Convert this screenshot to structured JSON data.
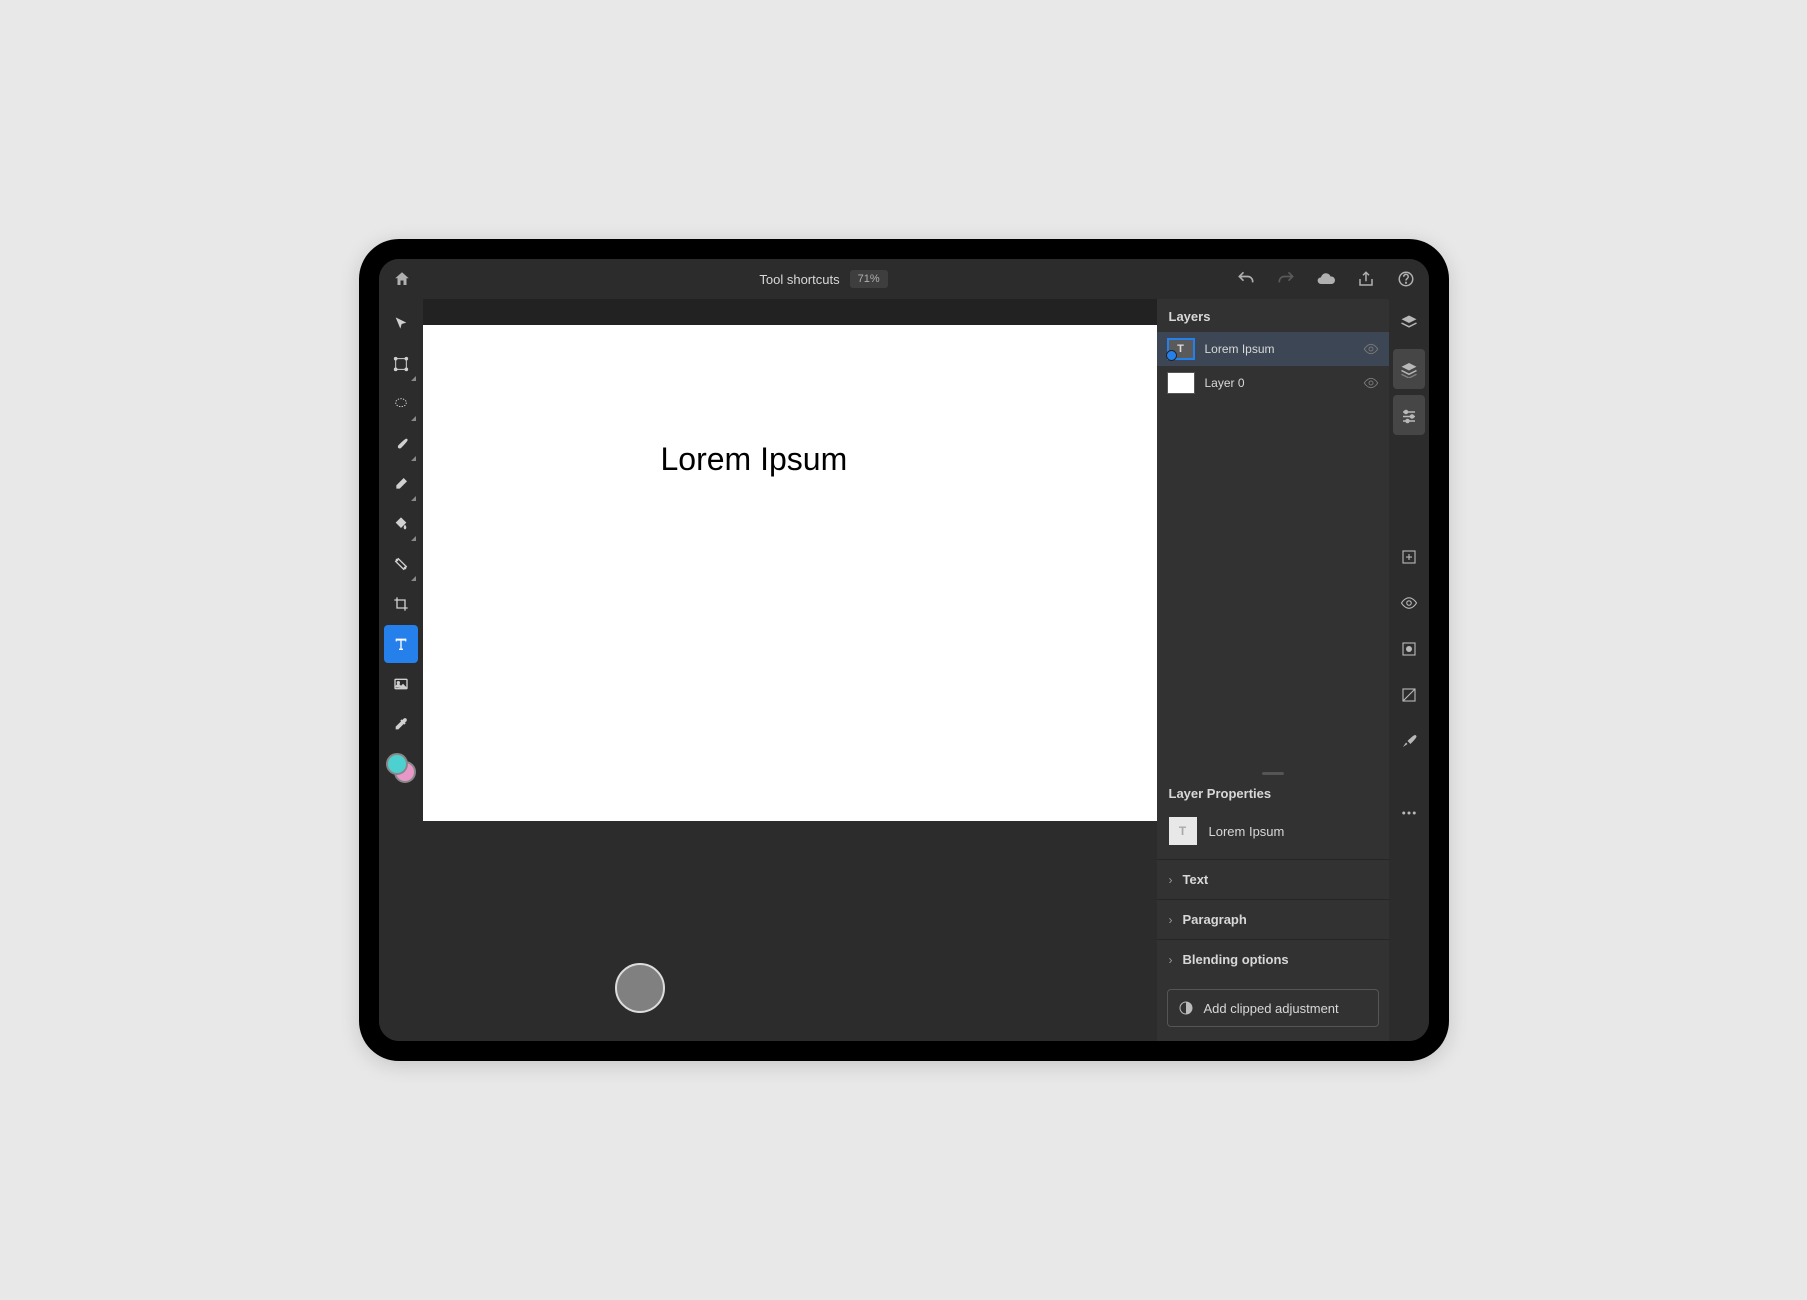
{
  "header": {
    "title": "Tool shortcuts",
    "zoom": "71%"
  },
  "canvas": {
    "text": "Lorem Ipsum"
  },
  "layers": {
    "title": "Layers",
    "items": [
      {
        "name": "Lorem Ipsum",
        "type": "text",
        "selected": true
      },
      {
        "name": "Layer 0",
        "type": "pixel",
        "selected": false
      }
    ]
  },
  "properties": {
    "title": "Layer Properties",
    "layer_name": "Lorem Ipsum",
    "groups": [
      {
        "label": "Text"
      },
      {
        "label": "Paragraph"
      },
      {
        "label": "Blending options"
      }
    ],
    "add_adjustment": "Add clipped adjustment"
  },
  "tools": [
    {
      "id": "move",
      "corner": false
    },
    {
      "id": "transform",
      "corner": true
    },
    {
      "id": "lasso",
      "corner": true
    },
    {
      "id": "brush",
      "corner": true
    },
    {
      "id": "eraser",
      "corner": true
    },
    {
      "id": "fill",
      "corner": true
    },
    {
      "id": "healing",
      "corner": true
    },
    {
      "id": "crop",
      "corner": false
    },
    {
      "id": "type",
      "corner": false,
      "active": true
    },
    {
      "id": "place",
      "corner": false
    },
    {
      "id": "eyedropper",
      "corner": false
    }
  ],
  "colors": {
    "foreground": "#4dd0d0",
    "background": "#e898c8"
  }
}
